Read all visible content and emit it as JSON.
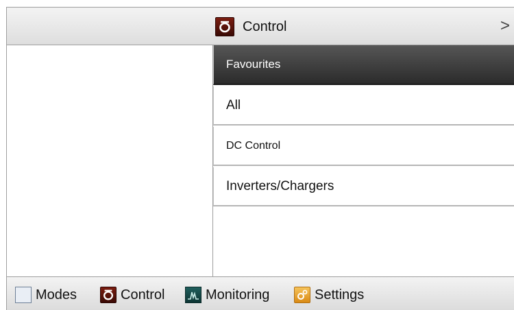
{
  "header": {
    "title": "Control",
    "next_label": ">",
    "icon": "control-icon"
  },
  "list": {
    "items": [
      {
        "label": "Favourites",
        "selected": true
      },
      {
        "label": "All"
      },
      {
        "label": "DC Control"
      },
      {
        "label": "Inverters/Chargers"
      }
    ]
  },
  "footer": {
    "items": [
      {
        "label": "Modes",
        "icon": "modes-icon"
      },
      {
        "label": "Control",
        "icon": "control-icon"
      },
      {
        "label": "Monitoring",
        "icon": "monitoring-icon"
      },
      {
        "label": "Settings",
        "icon": "settings-icon"
      }
    ]
  },
  "colors": {
    "selected_item_bg": "#3a3a3a",
    "control_icon_bg": "#5a130a",
    "settings_icon_bg": "#e8a22e",
    "monitoring_icon_bg": "#174a48",
    "bar_bg": "#e6e6e6"
  }
}
